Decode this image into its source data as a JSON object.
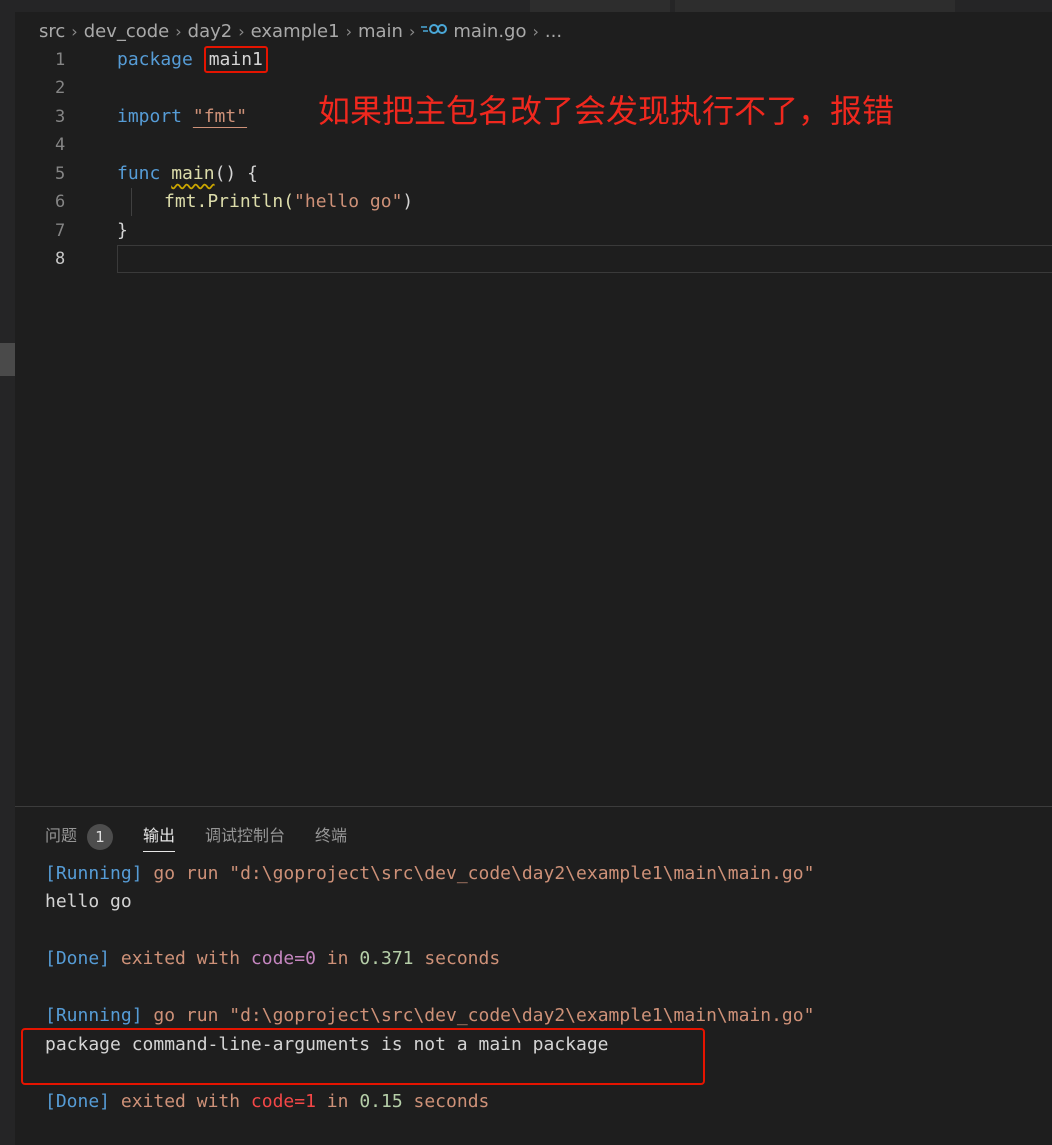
{
  "breadcrumb": {
    "items": [
      "src",
      "dev_code",
      "day2",
      "example1",
      "main"
    ],
    "file_icon": "go-file-icon",
    "file": "main.go",
    "more": "..."
  },
  "editor": {
    "line_numbers": [
      "1",
      "2",
      "3",
      "4",
      "5",
      "6",
      "7",
      "8"
    ],
    "active_line": "8",
    "code": {
      "l1_keyword": "package",
      "l1_name": "main1",
      "l3_keyword": "import",
      "l3_string": "\"fmt\"",
      "l5_keyword": "func",
      "l5_name": "main",
      "l5_rest": "() {",
      "l6_call": "fmt.Println(",
      "l6_string": "\"hello go\"",
      "l6_close": ")",
      "l7_brace": "}"
    }
  },
  "annotation": "如果把主包名改了会发现执行不了，报错",
  "panel": {
    "tabs": {
      "problems": "问题",
      "problems_count": "1",
      "output": "输出",
      "debug_console": "调试控制台",
      "terminal": "终端"
    },
    "output": {
      "run1_tag": "[Running]",
      "run1_cmd": " go run \"d:\\goproject\\src\\dev_code\\day2\\example1\\main\\main.go\"",
      "run1_result": "hello go",
      "done1_tag": "[Done]",
      "done1_exited": " exited with ",
      "done1_code": "code=0",
      "done1_in": " in ",
      "done1_time": "0.371",
      "done1_seconds": " seconds",
      "run2_tag": "[Running]",
      "run2_cmd": " go run \"d:\\goproject\\src\\dev_code\\day2\\example1\\main\\main.go\"",
      "run2_error": "package command-line-arguments is not a main package",
      "done2_tag": "[Done]",
      "done2_exited": " exited with ",
      "done2_code": "code=1",
      "done2_in": " in ",
      "done2_time": "0.15",
      "done2_seconds": " seconds"
    }
  },
  "colors": {
    "background": "#1e1e1e",
    "keyword": "#569cd6",
    "string": "#ce9178",
    "function": "#dcdcaa",
    "annotation_red": "#f0281e",
    "highlight_box": "#e51400"
  }
}
